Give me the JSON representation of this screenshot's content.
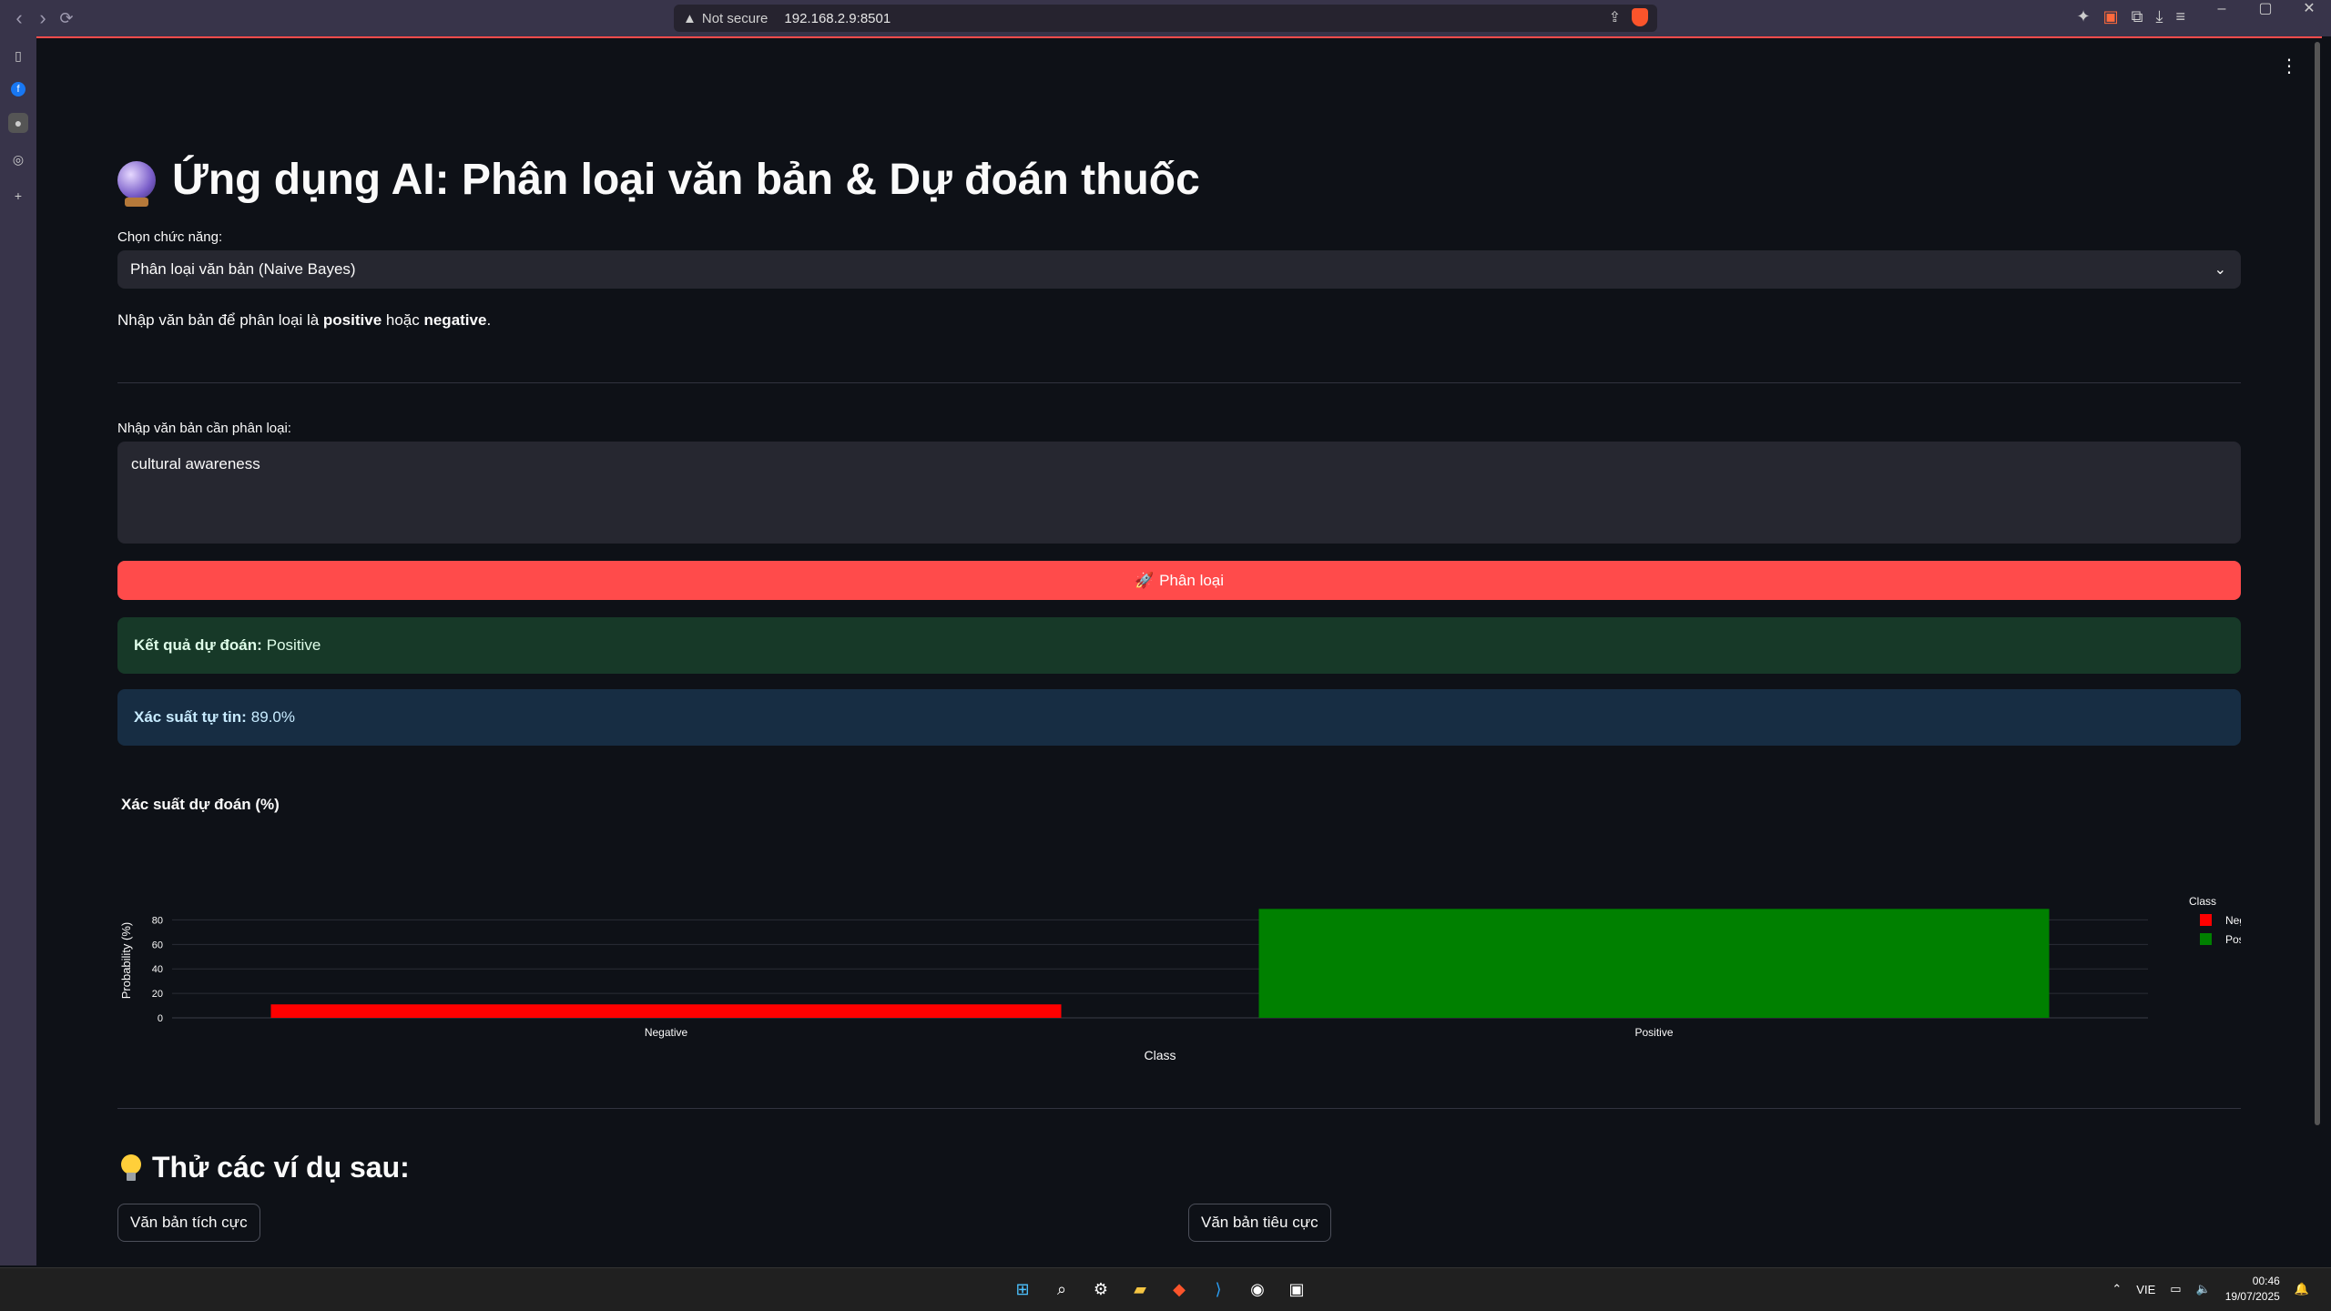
{
  "browser": {
    "not_secure": "Not secure",
    "url": "192.168.2.9:8501"
  },
  "app": {
    "title": "Ứng dụng AI: Phân loại văn bản & Dự đoán thuốc",
    "title_icon": "crystal-ball-icon",
    "select_label": "Chọn chức năng:",
    "select_value": "Phân loại văn bản (Naive Bayes)",
    "desc_pre": "Nhập văn bản để phân loại là ",
    "desc_pos": "positive",
    "desc_mid": " hoặc ",
    "desc_neg": "negative",
    "desc_end": ".",
    "textarea_label": "Nhập văn bản cần phân loại:",
    "textarea_value": "cultural awareness",
    "classify_button": "Phân loại",
    "result_label": "Kết quả dự đoán:",
    "result_value": "Positive",
    "confidence_label": "Xác suất tự tin:",
    "confidence_value": "89.0%",
    "chart_title": "Xác suất dự đoán (%)",
    "examples_title": "Thử các ví dụ sau:",
    "example_positive": "Văn bản tích cực",
    "example_negative": "Văn bản tiêu cực"
  },
  "chart_data": {
    "type": "bar",
    "categories": [
      "Negative",
      "Positive"
    ],
    "values": [
      11,
      89
    ],
    "colors": [
      "#ff0000",
      "#008000"
    ],
    "xlabel": "Class",
    "ylabel": "Probability (%)",
    "yticks": [
      0,
      20,
      40,
      60,
      80
    ],
    "ylim": [
      0,
      93.7
    ],
    "legend_title": "Class",
    "legend": [
      "Negative",
      "Positive"
    ],
    "legend_position": "top-right",
    "grid": true
  },
  "taskbar": {
    "lang": "VIE",
    "time": "00:46",
    "date": "19/07/2025"
  }
}
